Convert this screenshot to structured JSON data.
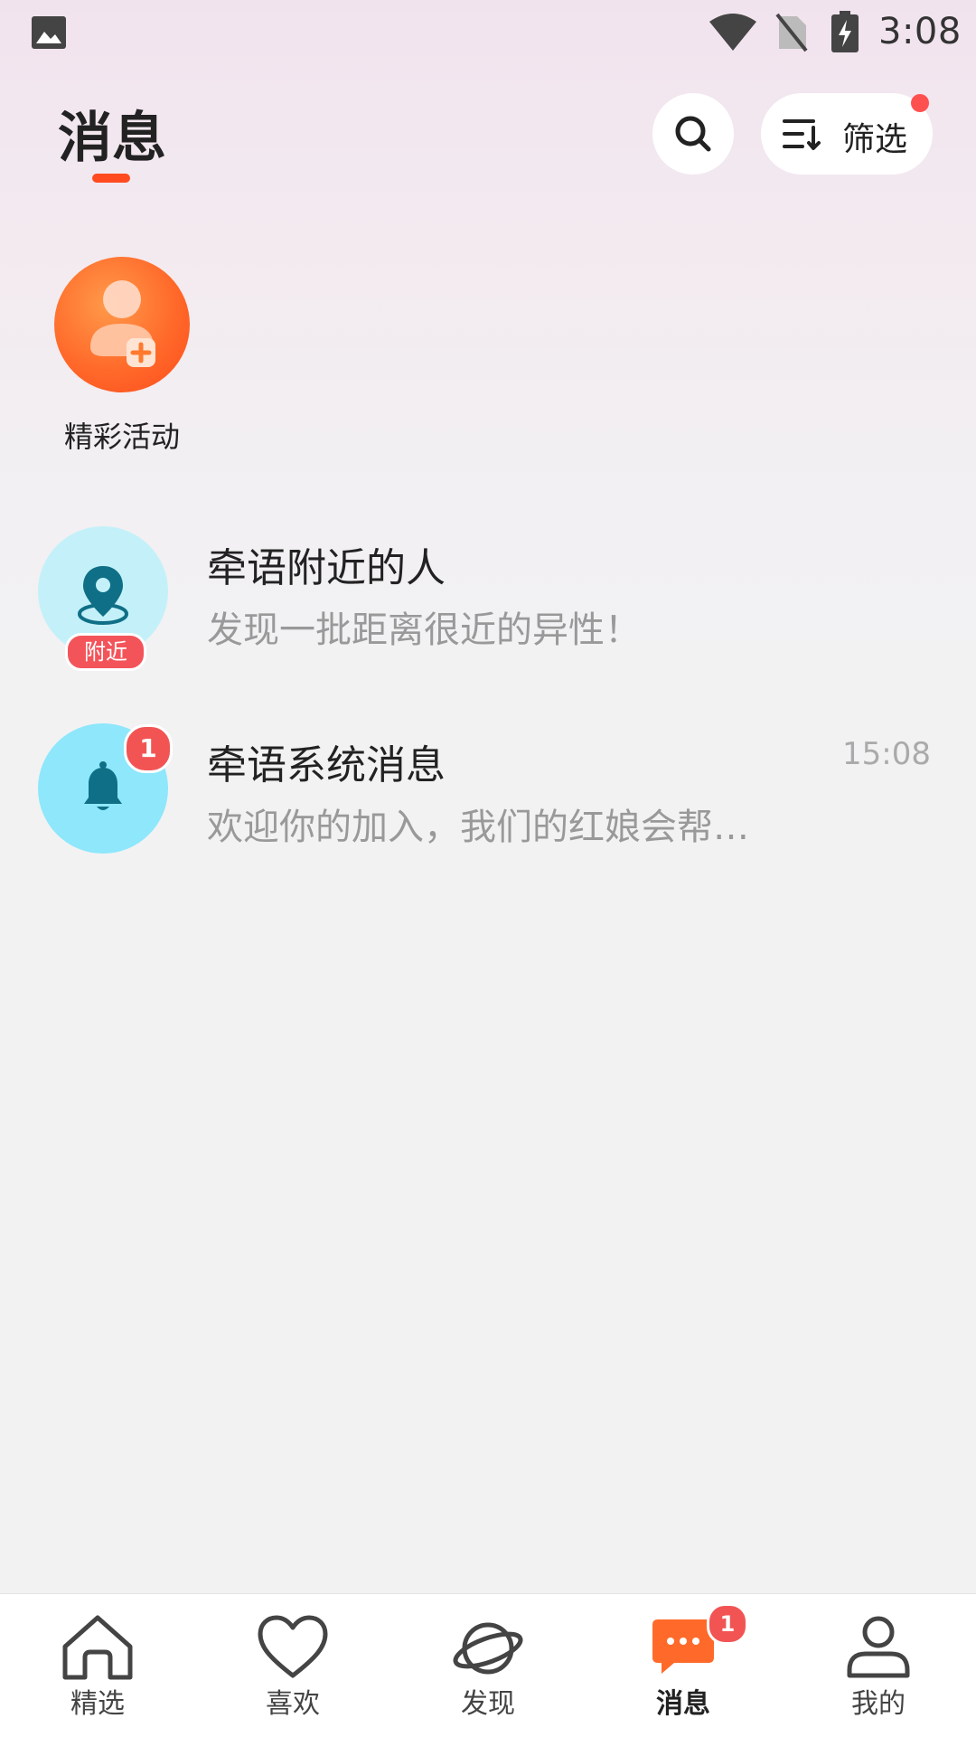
{
  "status_bar": {
    "time": "3:08",
    "icons": [
      "image-icon",
      "wifi-icon",
      "no-sim-icon",
      "battery-charging-icon"
    ]
  },
  "header": {
    "title": "消息",
    "search_icon": "search-icon",
    "filter_label": "筛选",
    "filter_icon": "sort-filter-icon",
    "filter_has_dot": true
  },
  "activity": {
    "label": "精彩活动",
    "icon": "user-plus-icon"
  },
  "conversations": [
    {
      "title": "牵语附近的人",
      "subtitle": "发现一批距离很近的异性！",
      "tag": "附近",
      "icon": "location-pin-icon",
      "avatar_color": "#c4f1f9"
    },
    {
      "title": "牵语系统消息",
      "subtitle": "欢迎你的加入，我们的红娘会帮…",
      "time": "15:08",
      "badge": "1",
      "icon": "bell-icon",
      "avatar_color": "#8ee7fb"
    }
  ],
  "bottom_nav": {
    "items": [
      {
        "label": "精选",
        "icon": "home-icon"
      },
      {
        "label": "喜欢",
        "icon": "heart-icon"
      },
      {
        "label": "发现",
        "icon": "planet-icon"
      },
      {
        "label": "消息",
        "icon": "chat-bubble-icon",
        "badge": "1",
        "active": true
      },
      {
        "label": "我的",
        "icon": "profile-icon"
      }
    ]
  },
  "colors": {
    "accent": "#ff4b1f",
    "badge": "#f25454",
    "nav_active": "#ff6a2a"
  }
}
